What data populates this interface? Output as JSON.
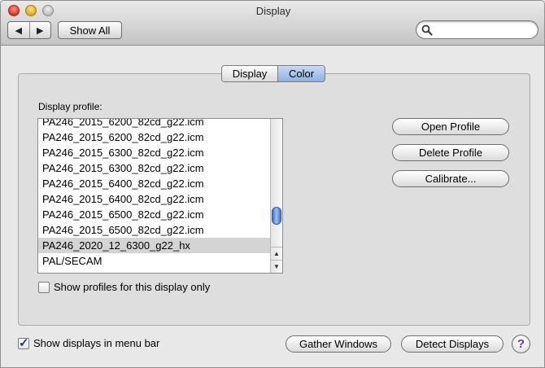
{
  "window": {
    "title": "Display",
    "nav_back_icon": "◀",
    "nav_forward_icon": "▶",
    "show_all_label": "Show All",
    "search": {
      "value": "",
      "placeholder": ""
    }
  },
  "tabs": [
    {
      "label": "Display",
      "selected": false
    },
    {
      "label": "Color",
      "selected": true
    }
  ],
  "profile_section": {
    "label": "Display profile:",
    "profiles": [
      "PA246_2015_6200_82cd_g22.icm",
      "PA246_2015_6200_82cd_g22.icm",
      "PA246_2015_6300_82cd_g22.icm",
      "PA246_2015_6300_82cd_g22.icm",
      "PA246_2015_6400_82cd_g22.icm",
      "PA246_2015_6400_82cd_g22.icm",
      "PA246_2015_6500_82cd_g22.icm",
      "PA246_2015_6500_82cd_g22.icm",
      "PA246_2020_12_6300_g22_hx",
      "PAL/SECAM"
    ],
    "selected_index": 8,
    "show_profiles_only_label": "Show profiles for this display only",
    "show_profiles_only_checked": false
  },
  "actions": {
    "open_profile": "Open Profile",
    "delete_profile": "Delete Profile",
    "calibrate": "Calibrate..."
  },
  "footer": {
    "show_in_menu_bar_label": "Show displays in menu bar",
    "show_in_menu_bar_checked": true,
    "gather_windows": "Gather Windows",
    "detect_displays": "Detect Displays",
    "help_label": "?"
  },
  "colors": {
    "selected_tab": "#8eb0e3",
    "selected_row": "#d4d4d4",
    "help_icon": "#6a2fb5"
  }
}
